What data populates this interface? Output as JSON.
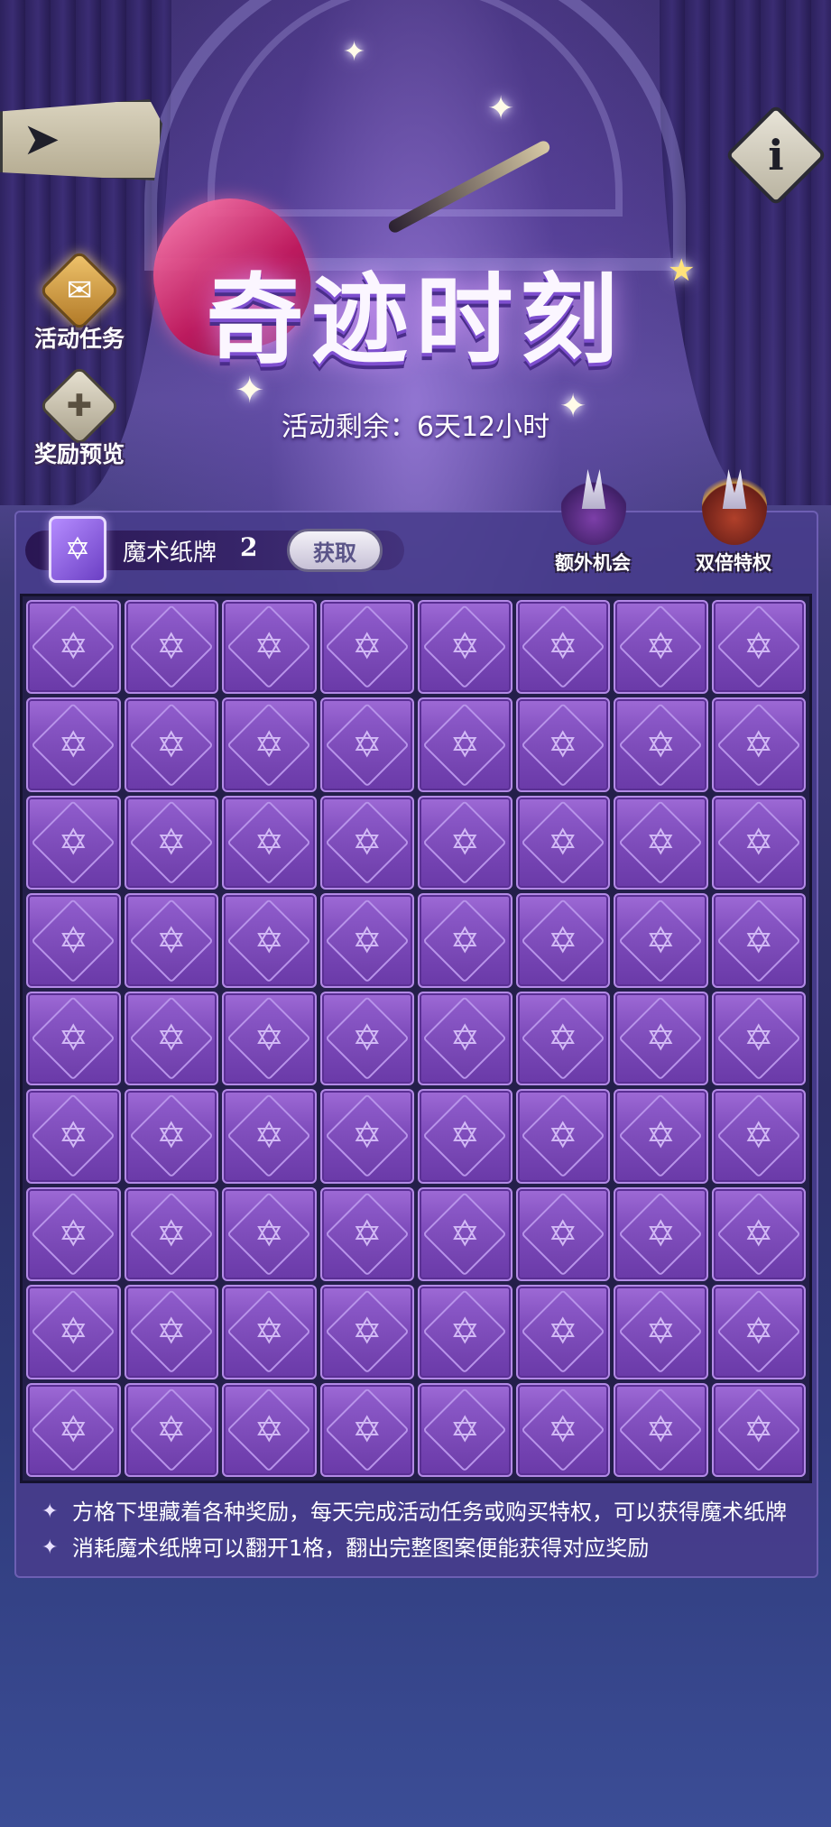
{
  "header": {
    "title": "奇迹时刻",
    "remaining": "活动剩余：6天12小时",
    "back_icon": "back-arrow-icon",
    "info_label": "i"
  },
  "side_buttons": [
    {
      "label": "活动任务",
      "icon": "scroll-icon"
    },
    {
      "label": "奖励预览",
      "icon": "gift-icon"
    }
  ],
  "resource": {
    "name": "魔术纸牌",
    "count": "2",
    "get_label": "获取",
    "icon": "magic-card-icon"
  },
  "perks": [
    {
      "label": "额外机会"
    },
    {
      "label": "双倍特权"
    }
  ],
  "board": {
    "columns": 8,
    "rows": 9,
    "cell_symbol": "✡"
  },
  "notes": [
    "方格下埋藏着各种奖励，每天完成活动任务或购买特权，可以获得魔术纸牌",
    "消耗魔术纸牌可以翻开1格，翻出完整图案便能获得对应奖励"
  ],
  "colors": {
    "cell_purple": "#7a48b8",
    "panel": "#483c8c",
    "gold": "#f0c46c"
  }
}
